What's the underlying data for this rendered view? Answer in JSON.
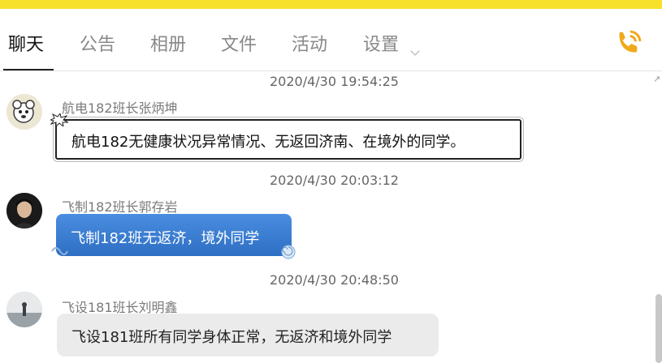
{
  "tabs": [
    {
      "label": "聊天",
      "active": true
    },
    {
      "label": "公告",
      "active": false
    },
    {
      "label": "相册",
      "active": false
    },
    {
      "label": "文件",
      "active": false
    },
    {
      "label": "活动",
      "active": false
    },
    {
      "label": "设置",
      "active": false
    }
  ],
  "colors": {
    "accent": "#f7e12b",
    "phone_icon": "#f0a81c",
    "bubble_blue": "#3a7fd6"
  },
  "messages": [
    {
      "time": "2020/4/30 19:54:25",
      "sender": "航电182班长张炳坤",
      "text": "航电182无健康状况异常情况、无返回济南、在境外的同学。"
    },
    {
      "time": "2020/4/30 20:03:12",
      "sender": "飞制182班长郭存岩",
      "text": "飞制182班无返济，境外同学"
    },
    {
      "time": "2020/4/30 20:48:50",
      "sender": "飞设181班长刘明鑫",
      "text": "飞设181班所有同学身体正常，无返济和境外同学"
    }
  ]
}
